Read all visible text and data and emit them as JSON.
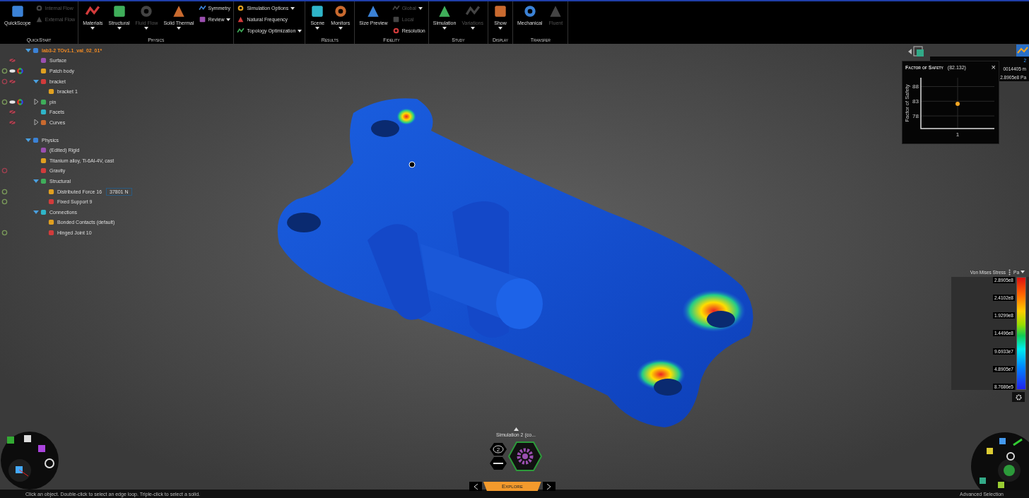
{
  "ribbon": {
    "groups": [
      {
        "label": "QuickStart",
        "tools": [
          {
            "label": "QuickScope",
            "kind": "large",
            "disabled": false,
            "dropdown": false
          },
          {
            "label": "Internal Flow",
            "kind": "small",
            "disabled": true,
            "dropdown": false
          },
          {
            "label": "External Flow",
            "kind": "small",
            "disabled": true,
            "dropdown": false
          }
        ]
      },
      {
        "label": "Physics",
        "tools": [
          {
            "label": "Materials",
            "kind": "large",
            "disabled": false,
            "dropdown": true
          },
          {
            "label": "Structural",
            "kind": "large",
            "disabled": false,
            "dropdown": true
          },
          {
            "label": "Fluid Flow",
            "kind": "large",
            "disabled": true,
            "dropdown": true
          },
          {
            "label": "Solid Thermal",
            "kind": "large",
            "disabled": false,
            "dropdown": true
          },
          {
            "label": "Symmetry",
            "kind": "small",
            "disabled": false,
            "dropdown": false
          },
          {
            "label": "Review",
            "kind": "small",
            "disabled": false,
            "dropdown": true
          }
        ]
      },
      {
        "tools": [
          {
            "label": "Simulation Options",
            "kind": "small",
            "disabled": false,
            "dropdown": true
          },
          {
            "label": "Natural Frequency",
            "kind": "small",
            "disabled": false,
            "dropdown": false
          },
          {
            "label": "Topology Optimization",
            "kind": "small",
            "disabled": false,
            "dropdown": true
          }
        ]
      },
      {
        "label": "Results",
        "tools": [
          {
            "label": "Scene",
            "kind": "large",
            "disabled": false,
            "dropdown": true
          },
          {
            "label": "Monitors",
            "kind": "large",
            "disabled": false,
            "dropdown": true
          }
        ]
      },
      {
        "label": "Fidelity",
        "tools": [
          {
            "label": "Size Preview",
            "kind": "large",
            "disabled": false,
            "dropdown": false
          },
          {
            "label": "Global",
            "kind": "small",
            "disabled": true,
            "dropdown": true
          },
          {
            "label": "Local",
            "kind": "small",
            "disabled": true,
            "dropdown": false
          },
          {
            "label": "Resolution",
            "kind": "small",
            "disabled": false,
            "dropdown": false
          }
        ]
      },
      {
        "label": "Study",
        "tools": [
          {
            "label": "Simulation",
            "kind": "large",
            "disabled": false,
            "dropdown": true
          },
          {
            "label": "Variations",
            "kind": "large",
            "disabled": true,
            "dropdown": true
          }
        ]
      },
      {
        "label": "Display",
        "tools": [
          {
            "label": "Show",
            "kind": "large",
            "disabled": false,
            "dropdown": true
          }
        ]
      },
      {
        "label": "Transfer",
        "tools": [
          {
            "label": "Mechanical",
            "kind": "large",
            "disabled": false,
            "dropdown": false
          },
          {
            "label": "Fluent",
            "kind": "large",
            "disabled": true,
            "dropdown": false
          }
        ]
      }
    ]
  },
  "model_tree": [
    {
      "label": "lab3-2 TOv1.1_val_02_01*",
      "current": true,
      "expanded": true,
      "children": [
        {
          "label": "Surface",
          "visible": false
        },
        {
          "label": "Patch body",
          "visible": true,
          "enabled": true,
          "color_wheel": true
        },
        {
          "label": "bracket",
          "visible": false,
          "enabled": false,
          "expanded": true,
          "children": [
            {
              "label": "bracket 1"
            }
          ]
        },
        {
          "label": "pin",
          "visible": true,
          "enabled": true,
          "color_wheel": true,
          "expanded": false
        },
        {
          "label": "Facets",
          "visible": false
        },
        {
          "label": "Curves",
          "visible": false,
          "expanded": false
        }
      ]
    }
  ],
  "physics_tree": [
    {
      "label": "Physics",
      "expanded": true,
      "children": [
        {
          "label": "(Edited) Rigid"
        },
        {
          "label": "Titanium alloy, Ti-6Al-4V, cast"
        },
        {
          "label": "Gravity",
          "enabled": false
        },
        {
          "label": "Structural",
          "expanded": true,
          "children": [
            {
              "label": "Distributed Force 16",
              "enabled": true,
              "value": "37801 N"
            },
            {
              "label": "Fixed Support 9",
              "enabled": true
            }
          ]
        },
        {
          "label": "Connections",
          "expanded": true,
          "children": [
            {
              "label": "Bonded Contacts (default)"
            },
            {
              "label": "Hinged Joint 10",
              "enabled": true
            }
          ]
        }
      ]
    }
  ],
  "results_panel": [
    {
      "value": "2"
    },
    {
      "value": "0014405 m"
    },
    {
      "value": "2.8905e8 Pa"
    }
  ],
  "monitor_chart": {
    "title": "Factor of Safety",
    "value_label": "(82.132)",
    "close": "×",
    "chart_data": {
      "type": "scatter",
      "ylabel": "Factor of Safety",
      "categories": [
        "1"
      ],
      "grid": true,
      "series": [
        {
          "color": "#f5a623",
          "values": [
            82.1
          ]
        }
      ],
      "ylim": [
        73.7,
        91
      ],
      "yticks": [
        78,
        83,
        88
      ]
    }
  },
  "legend": {
    "title": "Von Mises Stress",
    "unit": "Pa",
    "labels": [
      "2.8905e8",
      "2.4102e8",
      "1.9299e8",
      "1.4496e8",
      "9.6933e7",
      "4.8905e7",
      "8.7686e5"
    ]
  },
  "simulation_switcher": {
    "label": "Simulation 2 (co...",
    "count": "2"
  },
  "mode_tab": {
    "label": "Explore"
  },
  "status_bar": {
    "hint": "Click an object. Double-click to select an edge loop. Triple-click to select a solid.",
    "mode": "Advanced Selection"
  }
}
